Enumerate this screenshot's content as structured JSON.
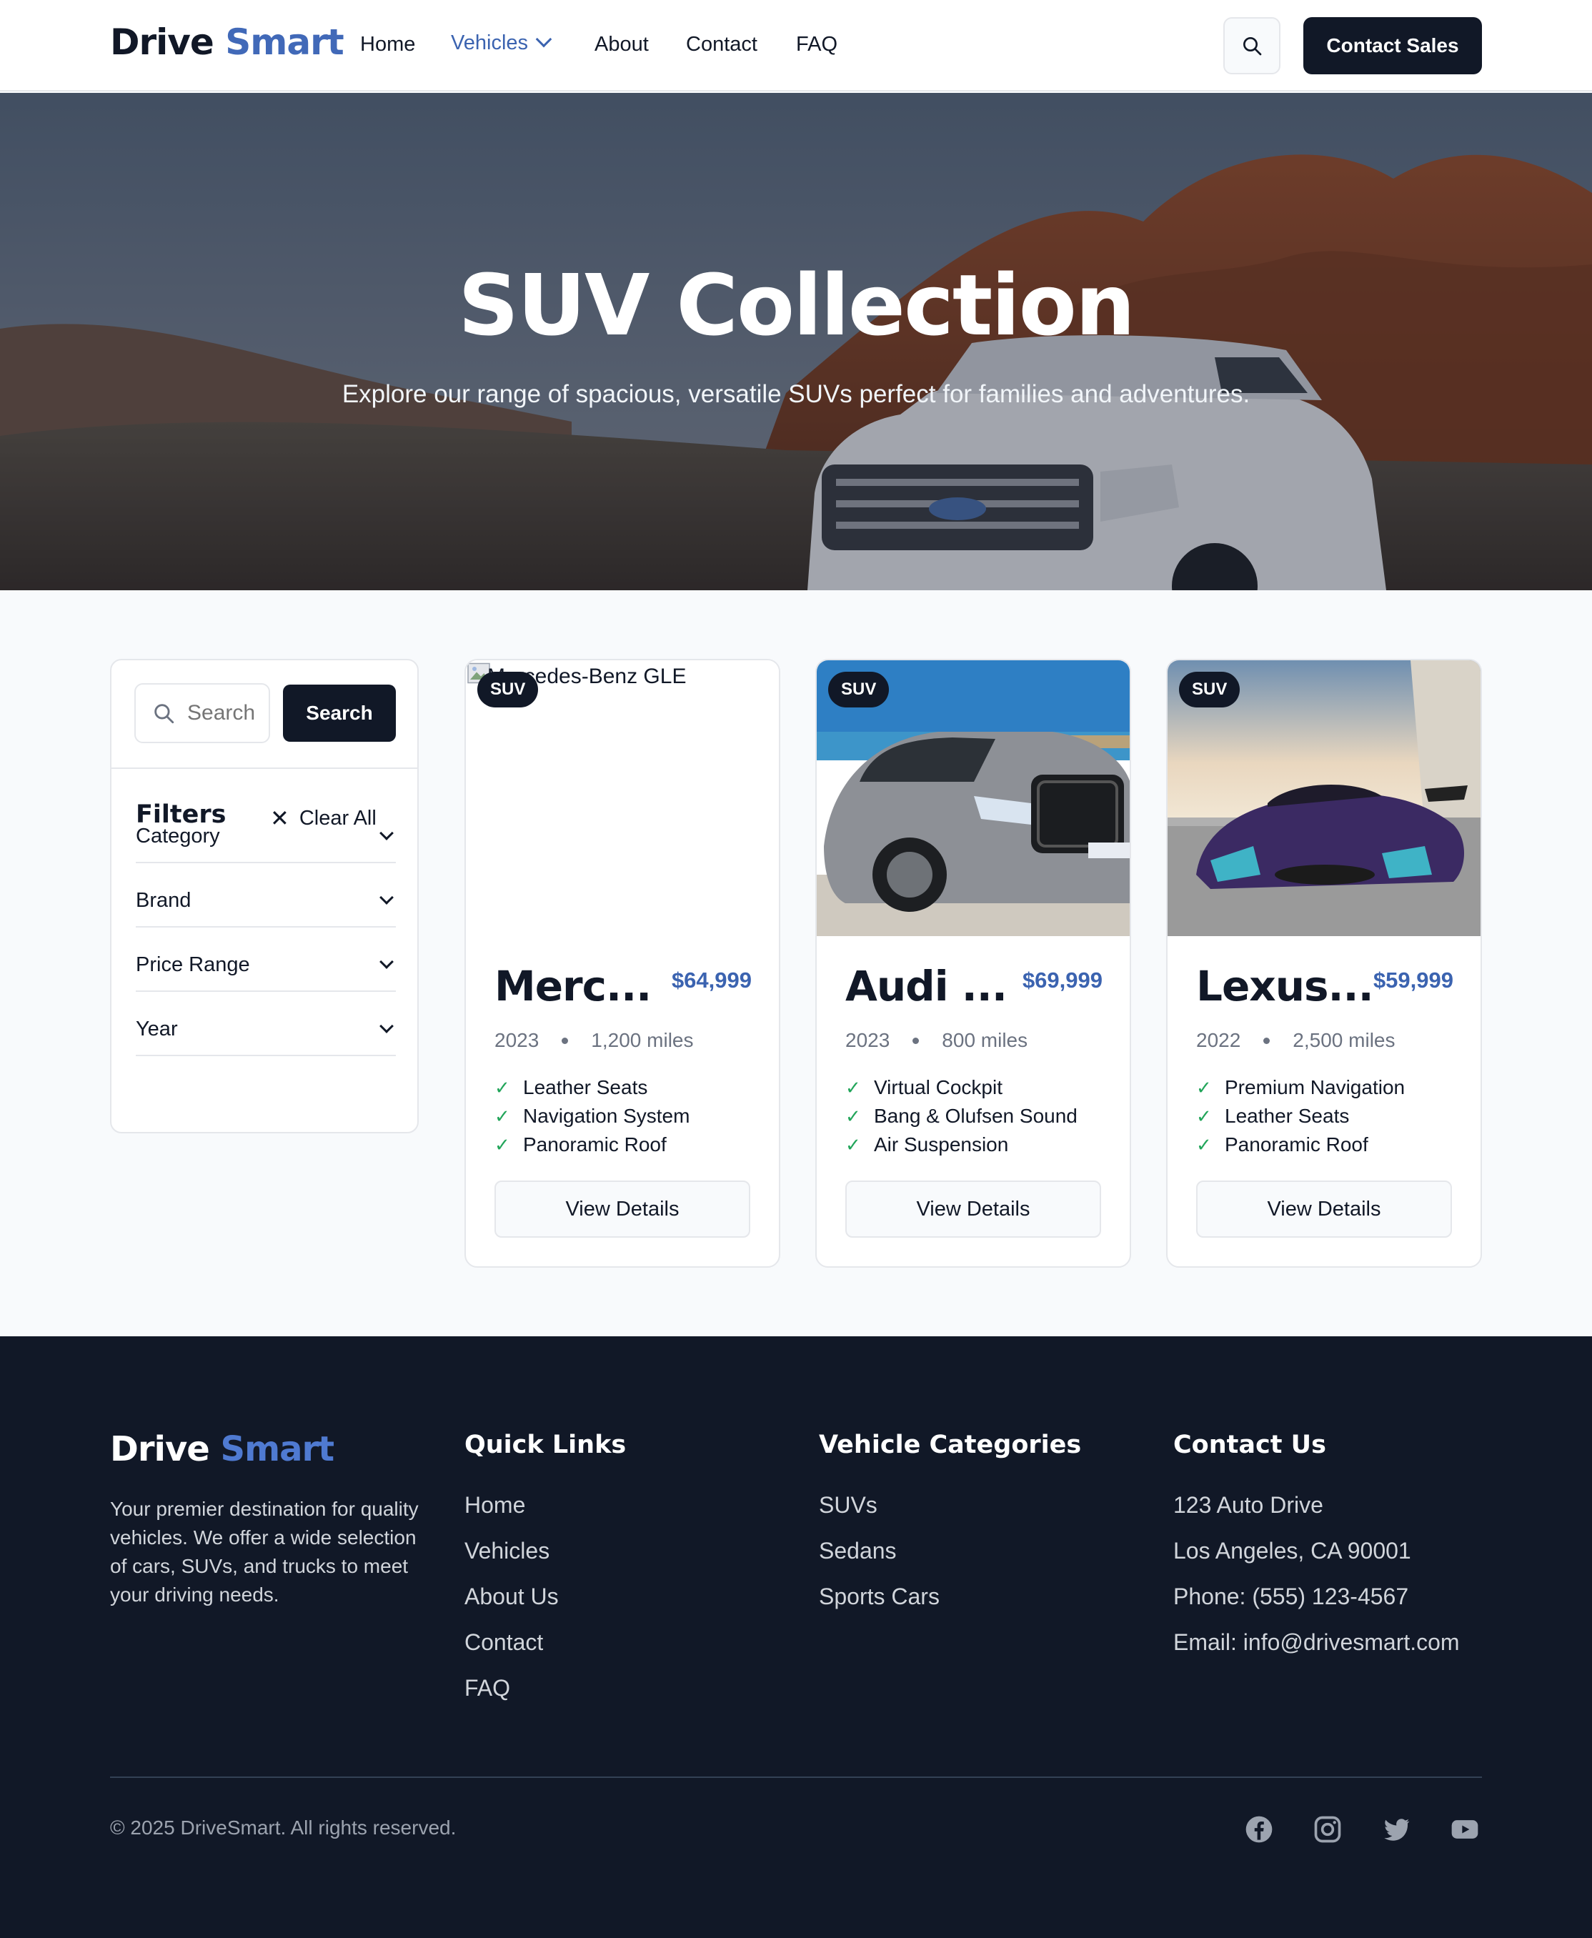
{
  "nav": {
    "brand_part1": "Drive",
    "brand_part2": "Smart",
    "links": [
      "Home",
      "Vehicles",
      "About",
      "Contact",
      "FAQ"
    ],
    "active": "Vehicles",
    "cta": "Contact Sales"
  },
  "hero": {
    "title": "SUV Collection",
    "subtitle": "Explore our range of spacious, versatile SUVs perfect for families and adventures."
  },
  "sidebar": {
    "search_placeholder": "Search",
    "search_button": "Search",
    "filters_title": "Filters",
    "clear_all": "Clear All",
    "filters": [
      "Category",
      "Brand",
      "Price Range",
      "Year"
    ]
  },
  "vehicles": [
    {
      "badge": "SUV",
      "image_alt": "Mercedes-Benz GLE",
      "title": "Merc...",
      "price": "$64,999",
      "year": "2023",
      "miles": "1,200 miles",
      "features": [
        "Leather Seats",
        "Navigation System",
        "Panoramic Roof"
      ],
      "button": "View Details"
    },
    {
      "badge": "SUV",
      "title": "Audi ...",
      "price": "$69,999",
      "year": "2023",
      "miles": "800 miles",
      "features": [
        "Virtual Cockpit",
        "Bang & Olufsen Sound",
        "Air Suspension"
      ],
      "button": "View Details"
    },
    {
      "badge": "SUV",
      "title": "Lexus...",
      "price": "$59,999",
      "year": "2022",
      "miles": "2,500 miles",
      "features": [
        "Premium Navigation",
        "Leather Seats",
        "Panoramic Roof"
      ],
      "button": "View Details"
    }
  ],
  "footer": {
    "brand_part1": "Drive",
    "brand_part2": "Smart",
    "description": "Your premier destination for quality vehicles. We offer a wide selection of cars, SUVs, and trucks to meet your driving needs.",
    "quick_links_title": "Quick Links",
    "quick_links": [
      "Home",
      "Vehicles",
      "About Us",
      "Contact",
      "FAQ"
    ],
    "categories_title": "Vehicle Categories",
    "categories": [
      "SUVs",
      "Sedans",
      "Sports Cars"
    ],
    "contact_title": "Contact Us",
    "contact": [
      "123 Auto Drive",
      "Los Angeles, CA 90001",
      "Phone: (555) 123-4567",
      "Email: info@drivesmart.com"
    ],
    "copyright": "© 2025 DriveSmart. All rights reserved.",
    "social_icons": [
      "facebook-icon",
      "instagram-icon",
      "twitter-icon",
      "youtube-icon"
    ]
  },
  "colors": {
    "brand_blue": "#4169b8",
    "dark": "#111827",
    "check_green": "#22a55a"
  }
}
